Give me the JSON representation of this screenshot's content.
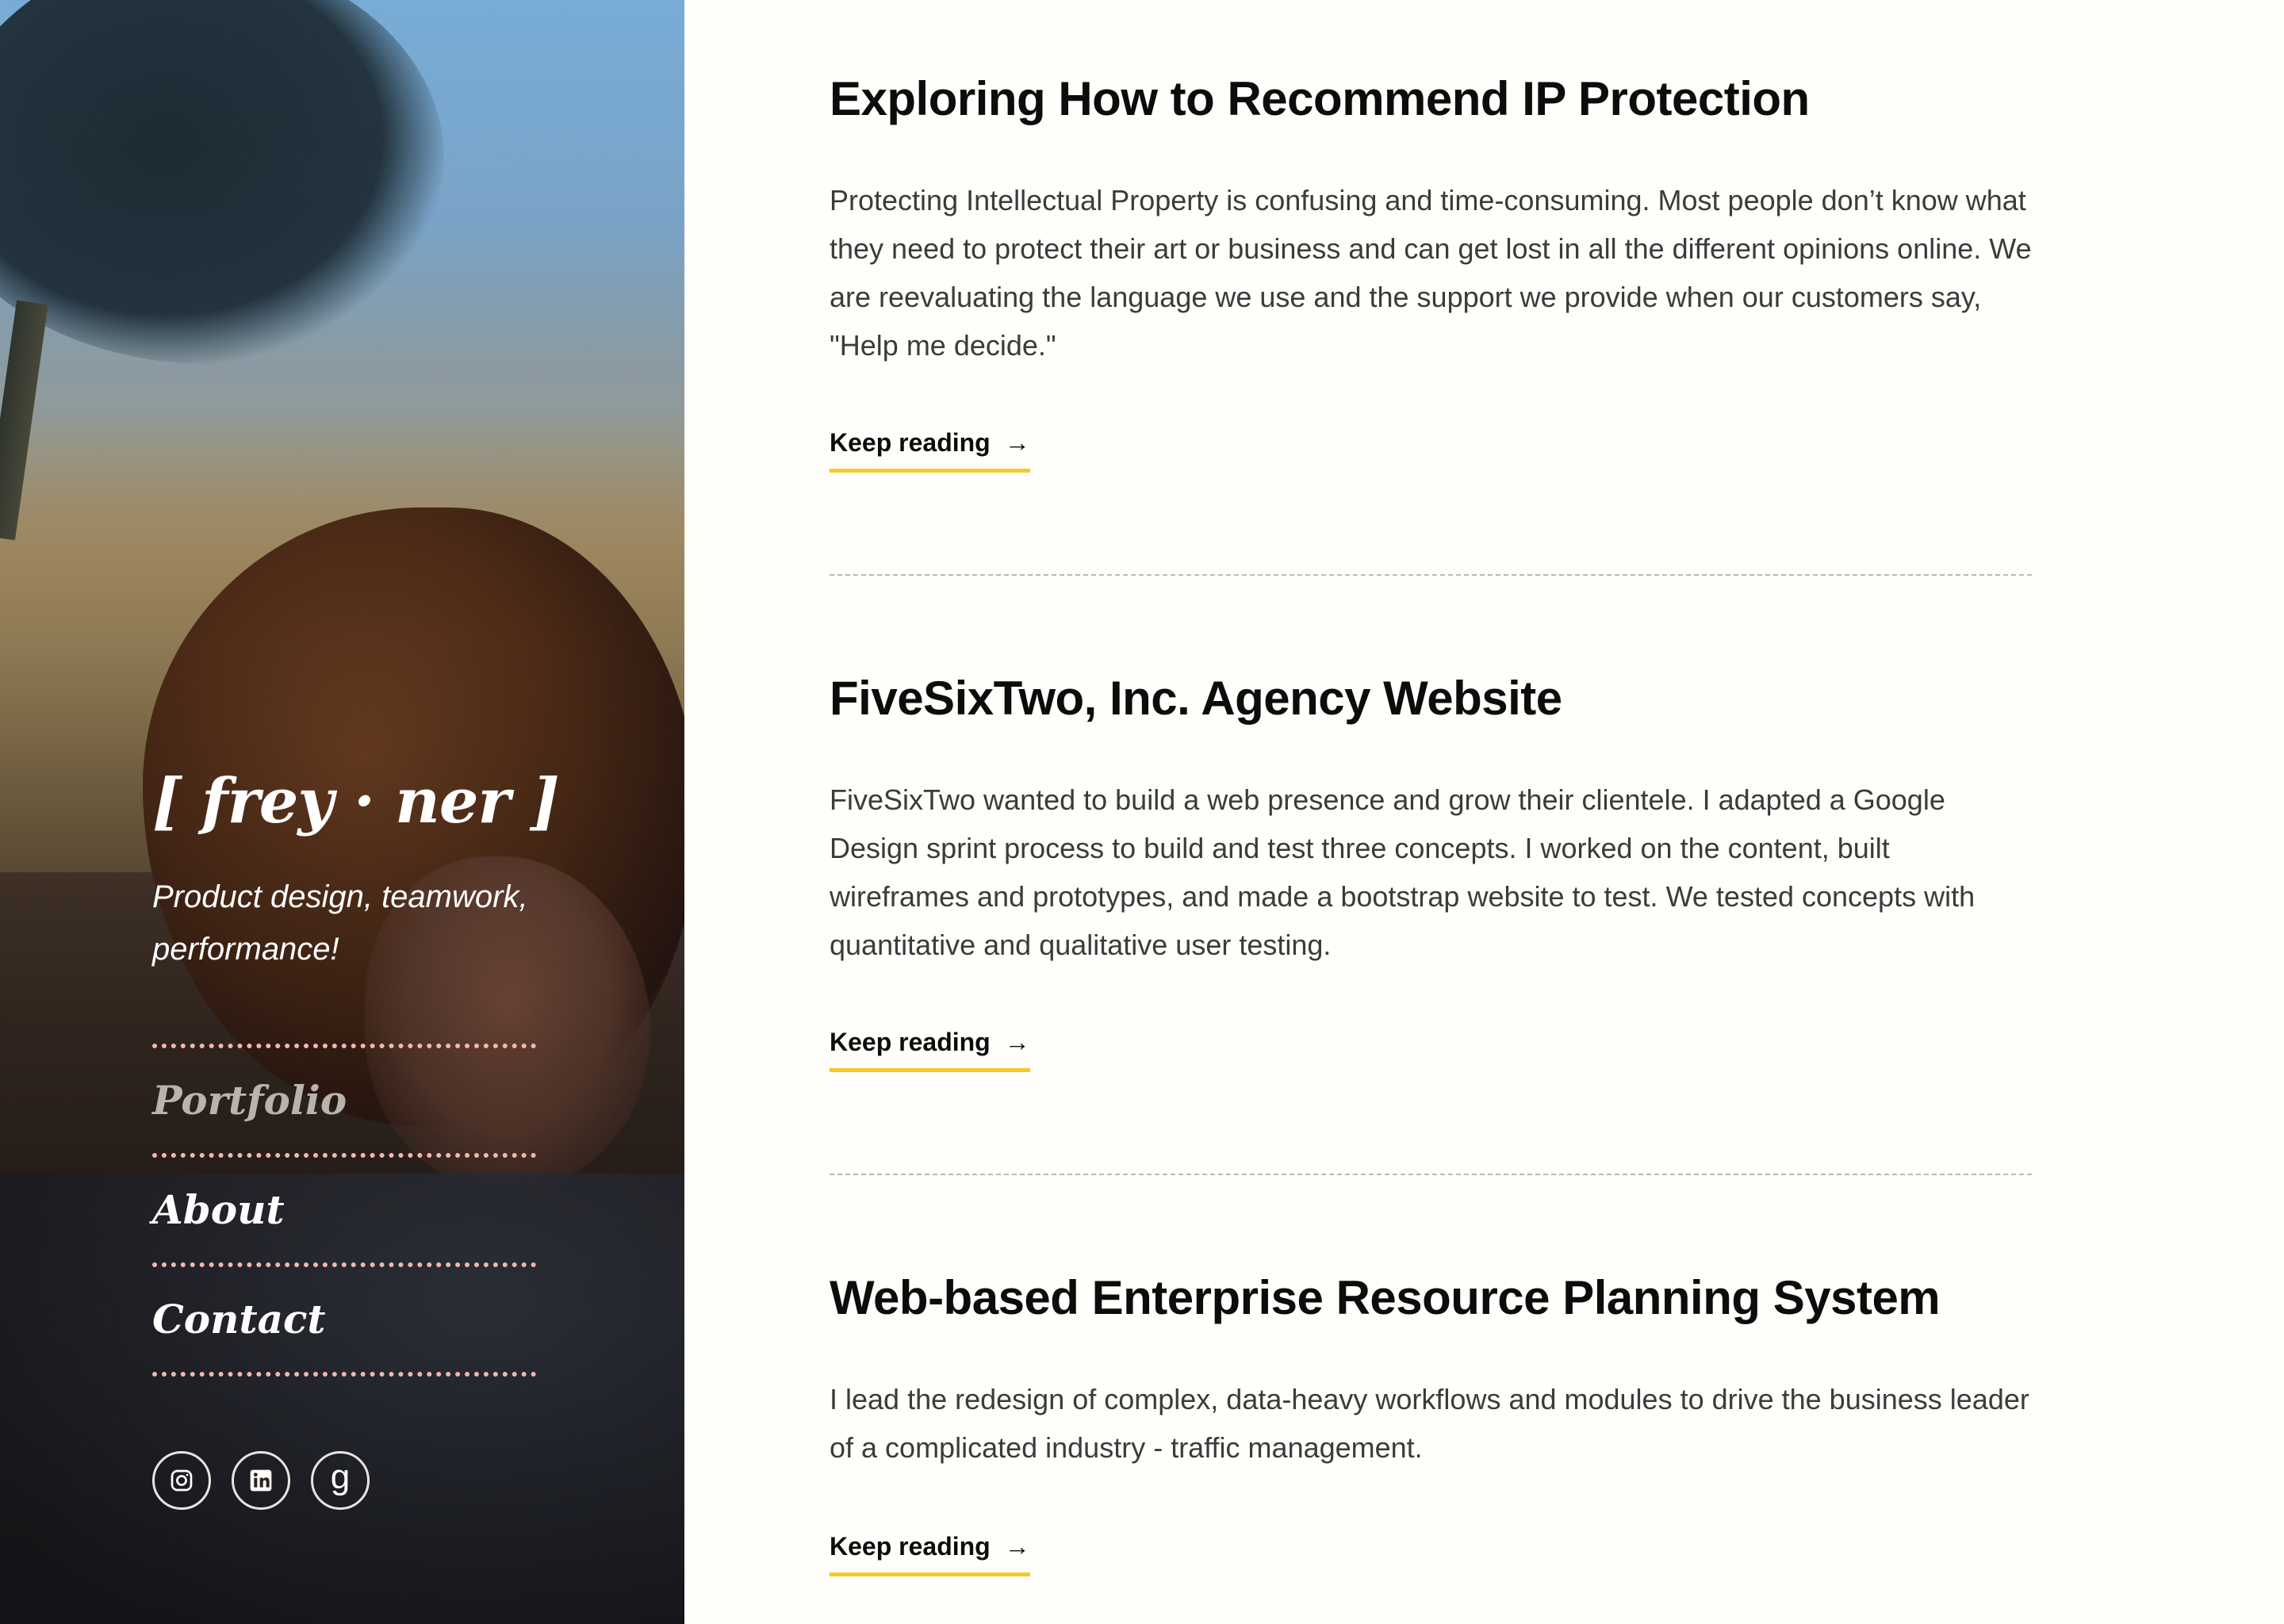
{
  "sidebar": {
    "brand": "[ frey · ner ]",
    "tagline": "Product design, teamwork, performance!",
    "nav": [
      {
        "label": "Portfolio"
      },
      {
        "label": "About"
      },
      {
        "label": "Contact"
      }
    ],
    "social": [
      {
        "icon": "instagram-icon"
      },
      {
        "icon": "linkedin-icon"
      },
      {
        "icon": "goodreads-icon",
        "glyph": "g"
      }
    ]
  },
  "posts": [
    {
      "title": "Exploring How to Recommend IP Protection",
      "excerpt": "Protecting Intellectual Property is confusing and time-consuming. Most people don’t know what they need to protect their art or business and can get lost in all the different opinions online. We are reevaluating the language we use and the support we provide when our customers say, \"Help me decide.\"",
      "link": "Keep reading"
    },
    {
      "title": "FiveSixTwo, Inc. Agency Website",
      "excerpt": "FiveSixTwo wanted to build a web presence and grow their clientele. I adapted a Google Design sprint process to build and test three concepts. I worked on the content, built wireframes and prototypes, and made a bootstrap website to test. We tested concepts with quantitative and qualitative user testing.",
      "link": "Keep reading"
    },
    {
      "title": "Web-based Enterprise Resource Planning System",
      "excerpt": "I lead the redesign of complex, data-heavy workflows and modules to drive the business leader of a complicated industry - traffic management.",
      "link": "Keep reading"
    }
  ],
  "arrow": "→",
  "colors": {
    "accent_underline": "#f5c928",
    "nav_rule": "#f3b7b0",
    "background": "#fffefb",
    "heading": "#0c0c0c",
    "body_text": "#3b3b3b"
  }
}
